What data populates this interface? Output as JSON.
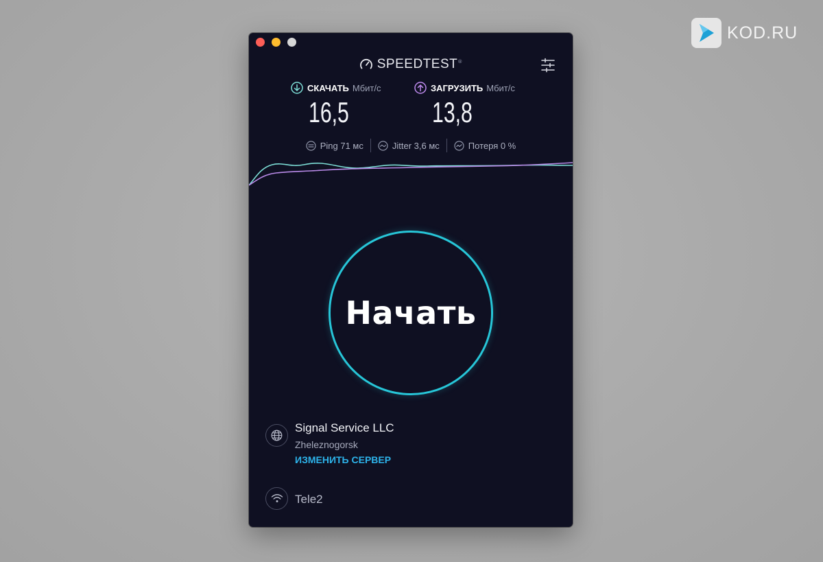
{
  "watermark": {
    "text": "KOD.RU"
  },
  "app": {
    "title": "SPEEDTEST",
    "trademark": "®"
  },
  "download": {
    "label": "СКАЧАТЬ",
    "unit": "Мбит/с",
    "value": "16,5",
    "color": "#7ee0d8"
  },
  "upload": {
    "label": "ЗАГРУЗИТЬ",
    "unit": "Мбит/с",
    "value": "13,8",
    "color": "#c08cf0"
  },
  "stats": {
    "ping": "Ping 71 мс",
    "jitter": "Jitter 3,6 мс",
    "loss": "Потеря 0 %"
  },
  "start_button": {
    "label": "Начать",
    "color": "#27c6d8"
  },
  "server": {
    "name": "Signal Service LLC",
    "city": "Zheleznogorsk",
    "change_label": "ИЗМЕНИТЬ СЕРВЕР"
  },
  "isp": {
    "name": "Tele2"
  },
  "icons": [
    "gauge-icon",
    "settings-sliders-icon",
    "download-arrow-icon",
    "upload-arrow-icon",
    "ping-icon",
    "jitter-icon",
    "packet-loss-icon",
    "globe-icon",
    "wifi-icon"
  ]
}
